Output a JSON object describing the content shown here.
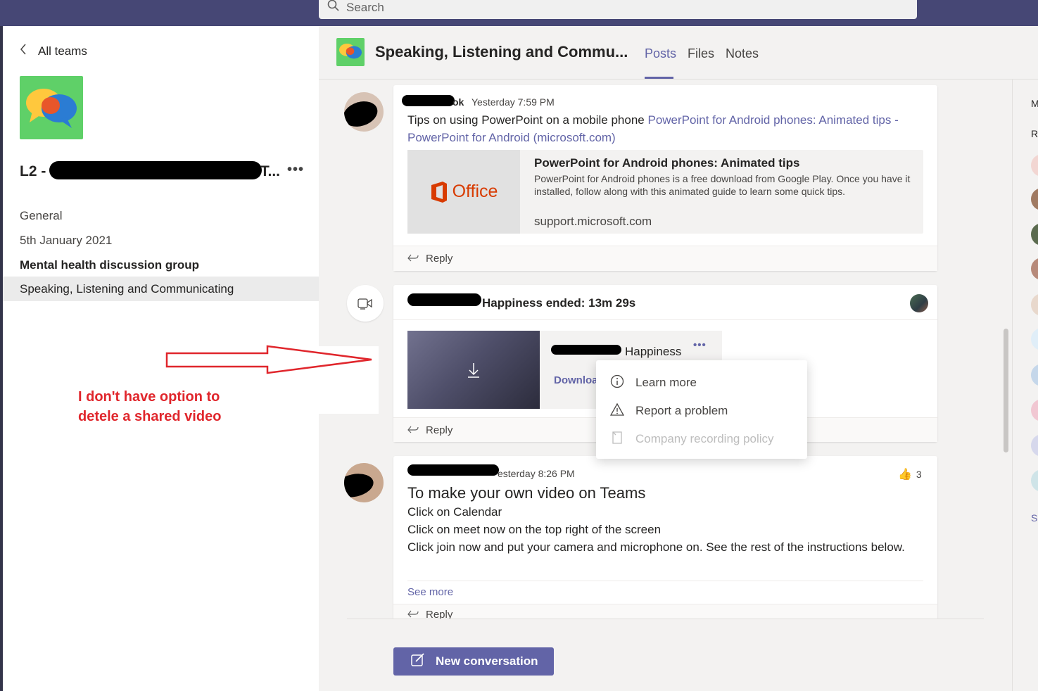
{
  "search": {
    "placeholder": "Search"
  },
  "sidebar": {
    "back_label": "All teams",
    "team_name_prefix": "L2 -",
    "team_name_suffix": "T...",
    "more_label": "•••",
    "channels": [
      {
        "label": "General"
      },
      {
        "label": "5th January 2021"
      },
      {
        "label": "Mental health discussion group"
      },
      {
        "label": "Speaking, Listening and Communicating"
      }
    ]
  },
  "annotation": {
    "line1": "I don't have option to",
    "line2": "detele a shared video",
    "color": "#e0262c"
  },
  "channel_header": {
    "title": "Speaking, Listening and Commu...",
    "tabs": [
      {
        "label": "Posts"
      },
      {
        "label": "Files"
      },
      {
        "label": "Notes"
      }
    ],
    "accent": "#6264a7"
  },
  "right_panel": {
    "label_1": "M",
    "label_2": "Re",
    "label_3": "Se"
  },
  "posts": [
    {
      "author_visible": "ok",
      "timestamp": "Yesterday 7:59 PM",
      "text": "Tips on using PowerPoint on a mobile phone ",
      "link_text": "PowerPoint for Android phones: Animated tips - PowerPoint for Android (microsoft.com)",
      "preview": {
        "logo_text": "Office",
        "title": "PowerPoint for Android phones: Animated tips",
        "description": "PowerPoint for Android phones is a free download from Google Play. Once you have it installed, follow along with this animated guide to learn some quick tips.",
        "host": "support.microsoft.com"
      },
      "reply_label": "Reply"
    },
    {
      "meeting_title": "Happiness ended: 13m 29s",
      "recording_name": "Happiness",
      "download_label": "Downloa",
      "more_label": "•••",
      "reply_label": "Reply"
    },
    {
      "timestamp": "esterday 8:26 PM",
      "title": "To make your own video on Teams",
      "lines": [
        "Click on Calendar",
        "Click on meet now on the top right of the screen",
        "Click join now and put your camera and microphone on.  See the rest of the instructions below."
      ],
      "see_more_label": "See more",
      "reaction_count": "3",
      "reply_label": "Reply"
    }
  ],
  "context_menu": {
    "items": [
      {
        "label": "Learn more",
        "icon": "info-icon",
        "enabled": true
      },
      {
        "label": "Report a problem",
        "icon": "warning-icon",
        "enabled": true
      },
      {
        "label": "Company recording policy",
        "icon": "document-icon",
        "enabled": false
      }
    ]
  },
  "compose": {
    "new_conversation_label": "New conversation"
  }
}
